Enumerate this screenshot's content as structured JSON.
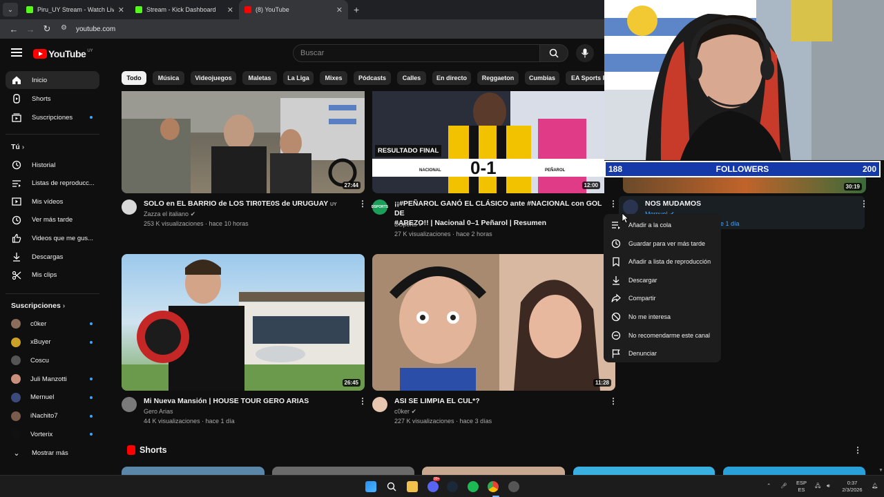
{
  "browser": {
    "tabs": [
      {
        "title": "Piru_UY Stream - Watch Live on",
        "favicon_color": "#53fc18"
      },
      {
        "title": "Stream - Kick Dashboard",
        "favicon_color": "#53fc18"
      },
      {
        "title": "(8) YouTube",
        "favicon_color": "#ff0000"
      }
    ],
    "url": "youtube.com"
  },
  "header": {
    "logo_text": "YouTube",
    "country_code": "UY",
    "search_placeholder": "Buscar"
  },
  "sidebar": {
    "main": [
      {
        "label": "Inicio",
        "icon": "home-icon"
      },
      {
        "label": "Shorts",
        "icon": "shorts-icon"
      },
      {
        "label": "Suscripciones",
        "icon": "subscriptions-icon"
      }
    ],
    "you_heading": "Tú",
    "you_chevron": "›",
    "you": [
      {
        "label": "Historial",
        "icon": "history-icon"
      },
      {
        "label": "Listas de reproducc...",
        "icon": "playlists-icon"
      },
      {
        "label": "Mis vídeos",
        "icon": "my-videos-icon"
      },
      {
        "label": "Ver más tarde",
        "icon": "watch-later-icon"
      },
      {
        "label": "Videos que me gus...",
        "icon": "liked-icon"
      },
      {
        "label": "Descargas",
        "icon": "downloads-icon"
      },
      {
        "label": "Mis clips",
        "icon": "clips-icon"
      }
    ],
    "subs_heading": "Suscripciones",
    "subs_chevron": "›",
    "subs": [
      {
        "label": "c0ker",
        "color": "#8a6d5a"
      },
      {
        "label": "xBuyer",
        "color": "#c9a227"
      },
      {
        "label": "Coscu",
        "color": "#555"
      },
      {
        "label": "Juli Manzotti",
        "color": "#c98f7a"
      },
      {
        "label": "Mernuel",
        "color": "#3b4a7a"
      },
      {
        "label": "iNachito7",
        "color": "#7a5a4a"
      },
      {
        "label": "Vorterix",
        "color": "#111"
      }
    ],
    "show_more": "Mostrar más"
  },
  "chips": [
    "Todo",
    "Música",
    "Videojuegos",
    "Maletas",
    "La Liga",
    "Mixes",
    "Pódcasts",
    "Calles",
    "En directo",
    "Reggaeton",
    "Cumbias",
    "EA Sports F"
  ],
  "videos": [
    {
      "title": "SOLO en EL BARRIO de LOS TIR0TE0S de URUGUAY",
      "flag": "UY",
      "channel": "Zazza el italiano",
      "meta": "253 K visualizaciones · hace 10 horas",
      "duration": "27:44"
    },
    {
      "title_line1": "¡¡#PEÑAROL GANÓ EL CLÁSICO ante #NACIONAL con GOL DE",
      "title_line2": "#AREZO!! | Nacional 0–1 Peñarol | Resumen",
      "channel": "DSports",
      "meta": "27 K visualizaciones · hace 2 horas",
      "duration": "12:00",
      "banner": "RESULTADO FINAL",
      "team_left": "NACIONAL",
      "score": "0-1",
      "team_right": "PEÑAROL",
      "brand": "DSPORTS"
    },
    {
      "title": "NOS MUDAMOS",
      "channel": "Mernuel",
      "meta": "e 1 día",
      "duration": "30:19"
    },
    {
      "title": "Mi Nueva Mansión | HOUSE TOUR GERO ARIAS",
      "channel": "Gero Arias",
      "meta": "44 K visualizaciones · hace 1 día",
      "duration": "26:45"
    },
    {
      "title": "ASI SE LIMPIA EL CUL*?",
      "channel": "c0ker",
      "meta": "227 K visualizaciones · hace 3 días",
      "duration": "11:28"
    }
  ],
  "context_menu": [
    {
      "label": "Añadir a la cola",
      "icon": "queue-icon"
    },
    {
      "label": "Guardar para ver más tarde",
      "icon": "clock-icon"
    },
    {
      "label": "Añadir a lista de reproducción",
      "icon": "bookmark-icon"
    },
    {
      "label": "Descargar",
      "icon": "download-icon"
    },
    {
      "label": "Compartir",
      "icon": "share-icon"
    },
    {
      "label": "No me interesa",
      "icon": "not-interested-icon"
    },
    {
      "label": "No recomendarme este canal",
      "icon": "remove-channel-icon"
    },
    {
      "label": "Denunciar",
      "icon": "flag-icon"
    }
  ],
  "shorts_heading": "Shorts",
  "overlay": {
    "followers_current": "188",
    "followers_label": "FOLLOWERS",
    "followers_goal": "200",
    "followers_progress": 0.94
  },
  "taskbar": {
    "lang": "ESP",
    "lang_sub": "ES",
    "time": "0:37",
    "date": "2/3/2026",
    "notif_badge": "99+"
  }
}
